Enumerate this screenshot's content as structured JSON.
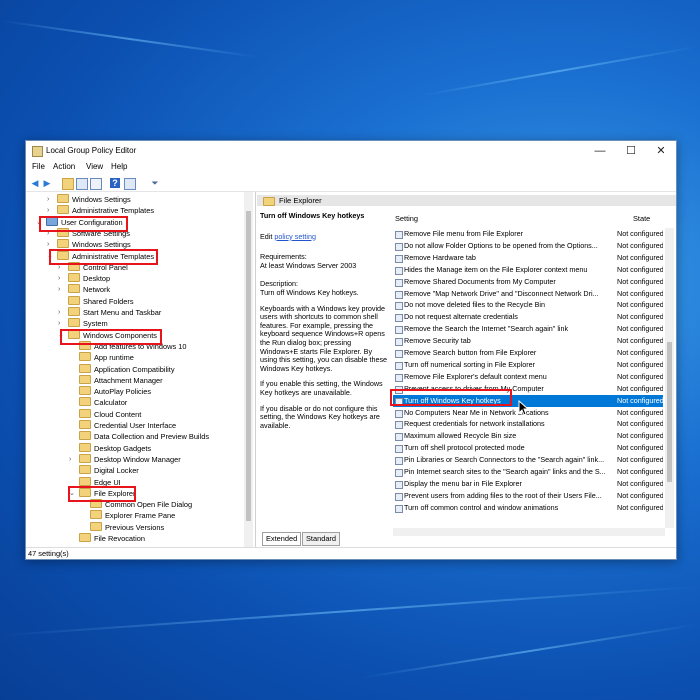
{
  "window": {
    "title": "Local Group Policy Editor",
    "controls": {
      "minimize": "—",
      "maximize": "☐",
      "close": "✕"
    }
  },
  "menu": [
    "File",
    "Action",
    "View",
    "Help"
  ],
  "tree": [
    {
      "label": "Windows Settings",
      "indent": 1,
      "chevron": ">"
    },
    {
      "label": "Administrative Templates",
      "indent": 1,
      "chevron": ">"
    },
    {
      "label": "User Configuration",
      "indent": 0,
      "chevron": "v",
      "icon": "computer"
    },
    {
      "label": "Software Settings",
      "indent": 1,
      "chevron": ">"
    },
    {
      "label": "Windows Settings",
      "indent": 1,
      "chevron": ">"
    },
    {
      "label": "Administrative Templates",
      "indent": 1,
      "chevron": "v"
    },
    {
      "label": "Control Panel",
      "indent": 2,
      "chevron": ">"
    },
    {
      "label": "Desktop",
      "indent": 2,
      "chevron": ">"
    },
    {
      "label": "Network",
      "indent": 2,
      "chevron": ">"
    },
    {
      "label": "Shared Folders",
      "indent": 2,
      "chevron": ""
    },
    {
      "label": "Start Menu and Taskbar",
      "indent": 2,
      "chevron": ">"
    },
    {
      "label": "System",
      "indent": 2,
      "chevron": ">"
    },
    {
      "label": "Windows Components",
      "indent": 2,
      "chevron": "v"
    },
    {
      "label": "Add features to Windows 10",
      "indent": 3,
      "chevron": ""
    },
    {
      "label": "App runtime",
      "indent": 3,
      "chevron": ""
    },
    {
      "label": "Application Compatibility",
      "indent": 3,
      "chevron": ""
    },
    {
      "label": "Attachment Manager",
      "indent": 3,
      "chevron": ""
    },
    {
      "label": "AutoPlay Policies",
      "indent": 3,
      "chevron": ""
    },
    {
      "label": "Calculator",
      "indent": 3,
      "chevron": ""
    },
    {
      "label": "Cloud Content",
      "indent": 3,
      "chevron": ""
    },
    {
      "label": "Credential User Interface",
      "indent": 3,
      "chevron": ""
    },
    {
      "label": "Data Collection and Preview Builds",
      "indent": 3,
      "chevron": ""
    },
    {
      "label": "Desktop Gadgets",
      "indent": 3,
      "chevron": ""
    },
    {
      "label": "Desktop Window Manager",
      "indent": 3,
      "chevron": ">"
    },
    {
      "label": "Digital Locker",
      "indent": 3,
      "chevron": ""
    },
    {
      "label": "Edge UI",
      "indent": 3,
      "chevron": ""
    },
    {
      "label": "File Explorer",
      "indent": 3,
      "chevron": "v"
    },
    {
      "label": "Common Open File Dialog",
      "indent": 4,
      "chevron": ""
    },
    {
      "label": "Explorer Frame Pane",
      "indent": 4,
      "chevron": ""
    },
    {
      "label": "Previous Versions",
      "indent": 4,
      "chevron": ""
    },
    {
      "label": "File Revocation",
      "indent": 3,
      "chevron": ""
    }
  ],
  "right_header": "File Explorer",
  "description": {
    "title": "Turn off Windows Key hotkeys",
    "edit_prefix": "Edit ",
    "edit_link": "policy setting",
    "requirements_label": "Requirements:",
    "requirements": "At least Windows Server 2003",
    "description_label": "Description:",
    "description_title": "Turn off Windows Key hotkeys.",
    "body1": "Keyboards with a Windows key provide users with shortcuts to common shell features. For example, pressing the keyboard sequence Windows+R opens the Run dialog box; pressing Windows+E starts File Explorer. By using this setting, you can disable these Windows Key hotkeys.",
    "body2": "If you enable this setting, the Windows Key hotkeys are unavailable.",
    "body3": "If you disable or do not configure this setting, the Windows Key hotkeys are available."
  },
  "list": {
    "col_setting": "Setting",
    "col_state": "State",
    "rows": [
      {
        "name": "Remove File menu from File Explorer",
        "state": "Not configured"
      },
      {
        "name": "Do not allow Folder Options to be opened from the Options...",
        "state": "Not configured"
      },
      {
        "name": "Remove Hardware tab",
        "state": "Not configured"
      },
      {
        "name": "Hides the Manage item on the File Explorer context menu",
        "state": "Not configured"
      },
      {
        "name": "Remove Shared Documents from My Computer",
        "state": "Not configured"
      },
      {
        "name": "Remove \"Map Network Drive\" and \"Disconnect Network Dri...",
        "state": "Not configured"
      },
      {
        "name": "Do not move deleted files to the Recycle Bin",
        "state": "Not configured"
      },
      {
        "name": "Do not request alternate credentials",
        "state": "Not configured"
      },
      {
        "name": "Remove the Search the Internet \"Search again\" link",
        "state": "Not configured"
      },
      {
        "name": "Remove Security tab",
        "state": "Not configured"
      },
      {
        "name": "Remove Search button from File Explorer",
        "state": "Not configured"
      },
      {
        "name": "Turn off numerical sorting in File Explorer",
        "state": "Not configured"
      },
      {
        "name": "Remove File Explorer's default context menu",
        "state": "Not configured"
      },
      {
        "name": "Prevent access to drives from My Computer",
        "state": "Not configured"
      },
      {
        "name": "Turn off Windows Key hotkeys",
        "state": "Not configured",
        "selected": true
      },
      {
        "name": "No Computers Near Me in Network Locations",
        "state": "Not configured"
      },
      {
        "name": "Request credentials for network installations",
        "state": "Not configured"
      },
      {
        "name": "Maximum allowed Recycle Bin size",
        "state": "Not configured"
      },
      {
        "name": "Turn off shell protocol protected mode",
        "state": "Not configured"
      },
      {
        "name": "Pin Libraries or Search Connectors to the \"Search again\" link...",
        "state": "Not configured"
      },
      {
        "name": "Pin Internet search sites to the \"Search again\" links and the S...",
        "state": "Not configured"
      },
      {
        "name": "Display the menu bar in File Explorer",
        "state": "Not configured"
      },
      {
        "name": "Prevent users from adding files to the root of their Users File...",
        "state": "Not configured"
      },
      {
        "name": "Turn off common control and window animations",
        "state": "Not configured"
      }
    ]
  },
  "tabs": [
    "Extended",
    "Standard"
  ],
  "status": "47 setting(s)",
  "colors": {
    "highlight": "#e8141b",
    "selection": "#0078d7"
  }
}
